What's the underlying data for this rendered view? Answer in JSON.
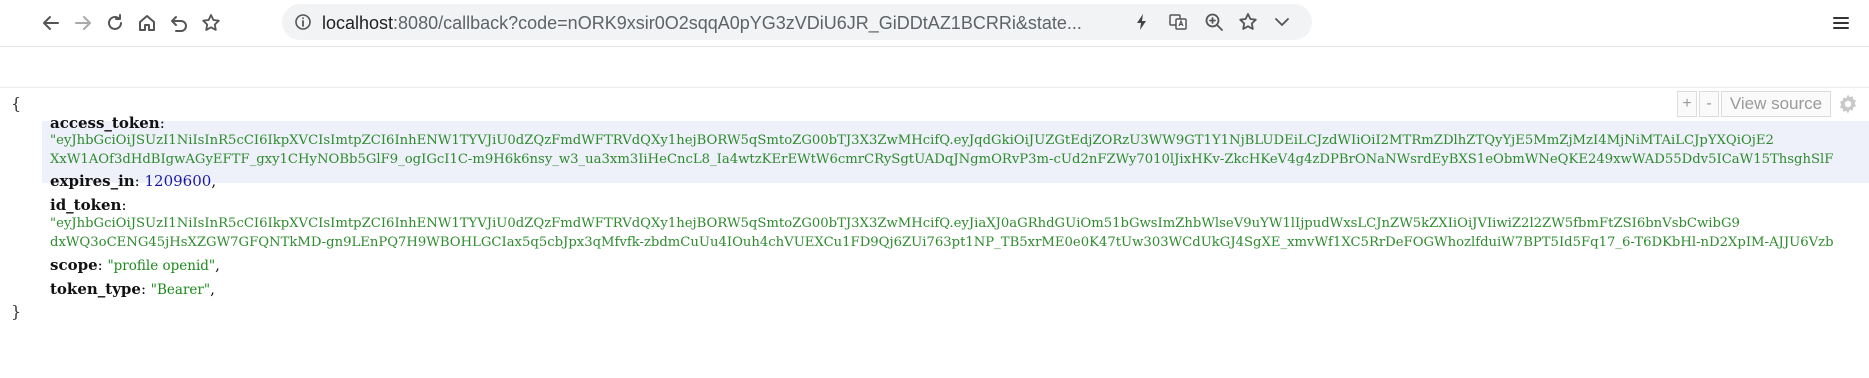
{
  "browser": {
    "url_host": "localhost",
    "url_rest": ":8080/callback?code=nORK9xsir0O2sqqA0pYG3zVDiU6JR_GiDDtAZ1BCRRi&state..."
  },
  "viewer": {
    "open_brace": "{",
    "close_brace": "}",
    "controls": {
      "plus": "+",
      "minus": "-",
      "view_source": "View source"
    },
    "fields": {
      "access_token": {
        "key": "access_token",
        "line1": "\"eyJhbGciOiJSUzI1NiIsInR5cCI6IkpXVCIsImtpZCI6InhENW1TYVJiU0dZQzFmdWFTRVdQXy1hejBORW5qSmtoZG00bTJ3X3ZwMHcifQ.eyJqdGkiOiJUZGtEdjZORzU3WW9GT1Y1NjBLUDEiLCJzdWIiOiI2MTRmZDlhZTQyYjE5MmZjMzI4MjNiMTAiLCJpYXQiOjE2",
        "line2": "XxW1AOf3dHdBIgwAGyEFTF_gxy1CHyNOBb5GlF9_ogIGcI1C-m9H6k6nsy_w3_ua3xm3IiHeCncL8_Ia4wtzKErEWtW6cmrCRySgtUADqJNgmORvP3m-cUd2nFZWy7010lJixHKv-ZkcHKeV4g4zDPBrONaNWsrdEyBXS1eObmWNeQKE249xwWAD55Ddv5ICaW15ThsghSlF"
      },
      "expires_in": {
        "key": "expires_in",
        "value": "1209600"
      },
      "id_token": {
        "key": "id_token",
        "line1": "\"eyJhbGciOiJSUzI1NiIsInR5cCI6IkpXVCIsImtpZCI6InhENW1TYVJiU0dZQzFmdWFTRVdQXy1hejBORW5qSmtoZG00bTJ3X3ZwMHcifQ.eyJiaXJ0aGRhdGUiOm51bGwsImZhbWlseV9uYW1lIjpudWxsLCJnZW5kZXIiOiJVIiwiZ2l2ZW5fbmFtZSI6bnVsbCwibG9",
        "line2": "dxWQ3oCENG45jHsXZGW7GFQNTkMD-gn9LEnPQ7H9WBOHLGCIax5q5cbJpx3qMfvfk-zbdmCuUu4IOuh4chVUEXCu1FD9Qj6ZUi763pt1NP_TB5xrME0e0K47tUw303WCdUkGJ4SgXE_xmvWf1XC5RrDeFOGWhozlfduiW7BPT5Id5Fq17_6-T6DKbHl-nD2XpIM-AJJU6Vzb"
      },
      "scope": {
        "key": "scope",
        "value": "\"profile openid\""
      },
      "token_type": {
        "key": "token_type",
        "value": "\"Bearer\""
      }
    }
  }
}
